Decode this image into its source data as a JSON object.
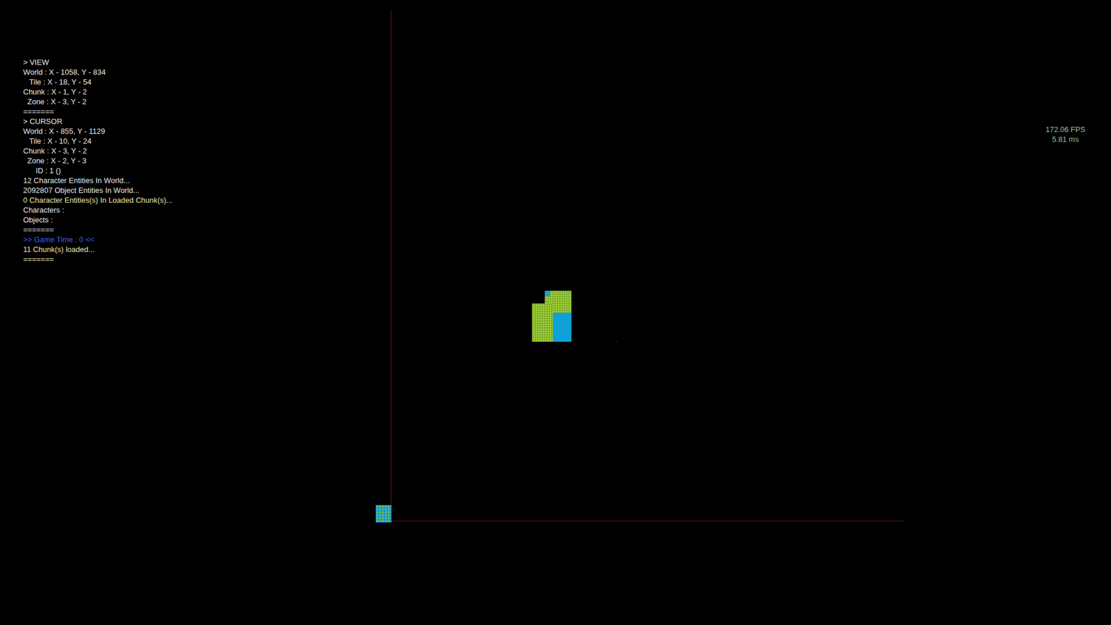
{
  "debug_lines": [
    {
      "text": "> VIEW",
      "color": "#e8e8e8"
    },
    {
      "text": "World : X - 1058, Y - 834",
      "color": "#e8e8e8"
    },
    {
      "text": "   Tile : X - 18, Y - 54",
      "color": "#e8e8e8"
    },
    {
      "text": "Chunk : X - 1, Y - 2",
      "color": "#e8e8e8"
    },
    {
      "text": "  Zone : X - 3, Y - 2",
      "color": "#e8e8e8"
    },
    {
      "text": "=======",
      "color": "#e8e8e8"
    },
    {
      "text": "> CURSOR",
      "color": "#e8e8e8"
    },
    {
      "text": "World : X - 855, Y - 1129",
      "color": "#e8e8e8"
    },
    {
      "text": "   Tile : X - 10, Y - 24",
      "color": "#e8e8e8"
    },
    {
      "text": "Chunk : X - 3, Y - 2",
      "color": "#e8e8e8"
    },
    {
      "text": "  Zone : X - 2, Y - 3",
      "color": "#e8e8e8"
    },
    {
      "text": "      ID : 1 ()",
      "color": "#e8e8e8"
    },
    {
      "text": "12 Character Entities In World...",
      "color": "#e8e8e8"
    },
    {
      "text": "2092807 Object Entities In World...",
      "color": "#e8e8e8"
    },
    {
      "text": "0 Character Entities(s) In Loaded Chunk(s)...",
      "color": "#f2e3a6"
    },
    {
      "text": "Characters :",
      "color": "#e8e8e8"
    },
    {
      "text": "Objects :",
      "color": "#e8e8e8"
    },
    {
      "text": "=======",
      "color": "#e8e8e8"
    },
    {
      "text": ">> Game Time : 0 <<",
      "color": "#3a5cf0"
    },
    {
      "text": "11 Chunk(s) loaded...",
      "color": "#f2e3a6"
    },
    {
      "text": "=======",
      "color": "#f2e3a6"
    }
  ],
  "perf": {
    "fps": "172.06 FPS",
    "frame_time": "5.81 ms"
  }
}
